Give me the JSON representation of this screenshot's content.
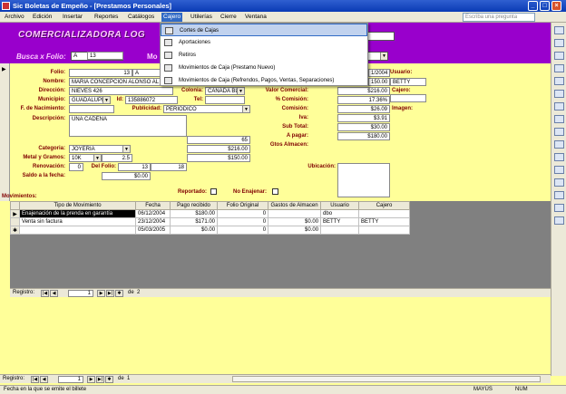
{
  "window": {
    "title": "Sic Boletas de Empeño - [Prestamos Personales]"
  },
  "menu": {
    "items": [
      "Archivo",
      "Edición",
      "Insertar",
      "Reportes",
      "Catálogos",
      "Cajero",
      "Utilerías",
      "Cierre",
      "Ventana"
    ],
    "help_placeholder": "Escriba una pregunta"
  },
  "cajero_menu": {
    "items": [
      "Cortes de Cajas",
      "Aportaciones",
      "Retiros",
      "Movimientos de Caja (Prestamo Nuevo)",
      "Movimientos de Caja (Refrendos, Pagos, Ventas, Separaciones)"
    ]
  },
  "header": {
    "company": "COMERCIALIZADORA LOG",
    "search_label": "Busca x Folio:",
    "search_value": "A",
    "search_value2": "13",
    "partial_label": "Mo"
  },
  "form": {
    "folio_label": "Folio:",
    "folio_prefix": "13",
    "folio_suffix": "A",
    "nombre_label": "Nombre:",
    "nombre_value": "MARIA CONCEPCION ALONSO AL",
    "direccion_label": "Dirección:",
    "direccion_value": "NIEVES 426",
    "colonia_label": "Colonia:",
    "colonia_value": "CAÑADA BL",
    "municipio_label": "Municipio:",
    "municipio_value": "GUADALUPI",
    "id_label": "Id:",
    "id_value": "135886072",
    "tel_label": "Tel:",
    "nacimiento_label": "F. de Nacimiento:",
    "publicidad_label": "Publicidad:",
    "publicidad_value": "PERIODICO",
    "descripcion_label": "Descripción:",
    "descripcion_value": "UNA CADENA",
    "num_65": "65",
    "num_216": "$216.00",
    "categoria_label": "Categoria:",
    "categoria_value": "JOYERIA",
    "metal_label": "Metal y Gramos:",
    "metal_value": "10K",
    "gramos_value": "2.5",
    "metal_amount": "$150.00",
    "renovacion_label": "Renovación:",
    "renovacion_value": "0",
    "del_folio_label": "Del Folio:",
    "del_folio_value": "13",
    "del_folio_value2": "18",
    "saldo_label": "Saldo a la fecha:",
    "saldo_value": "$0.00",
    "date_value": "1/2004",
    "usuario_label": "Usuario:",
    "usuario_value": "BETTY",
    "amount_150": "150.00",
    "valor_label": "Valor Comercial:",
    "valor_value": "$216.00",
    "cajero_label": "Cajero:",
    "comision_pct_label": "% Comisión:",
    "comision_pct_value": "17.36%",
    "imagen_label": "Imagen:",
    "comision_label": "Comisión:",
    "comision_value": "$26.09",
    "iva_label": "Iva:",
    "iva_value": "$3.91",
    "subtotal_label": "Sub Total:",
    "subtotal_value": "$30.00",
    "apagar_label": "A pagar:",
    "apagar_value": "$180.00",
    "gastos_label": "Gtos Almacen:",
    "ubicacion_label": "Ubicación:",
    "reportado_label": "Reportado:",
    "no_enajenar_label": "No Enajenar:",
    "movimientos_label": "Movimientos:"
  },
  "movements": {
    "headers": [
      "Tipo de Movimiento",
      "Fecha",
      "Pago recibido",
      "Folio Original",
      "Gastos de Almacen",
      "Usuario",
      "Cajero"
    ],
    "rows": [
      [
        "Enajenación de la prenda en garantía",
        "06/12/2004",
        "$180.00",
        "0",
        "",
        "dbo",
        ""
      ],
      [
        "Venta sin factura",
        "23/12/2004",
        "$171.00",
        "0",
        "$0.00",
        "BETTY",
        "BETTY"
      ],
      [
        "",
        "05/03/2005",
        "$0.00",
        "0",
        "$0.00",
        "",
        ""
      ]
    ]
  },
  "subnav": {
    "label": "Registro:",
    "current": "1",
    "of_label": "de",
    "total": "2"
  },
  "mainnav": {
    "label": "Registro:",
    "current": "1",
    "of_label": "de",
    "total": "1"
  },
  "status": {
    "text": "Fecha en la que se emite el billete",
    "caps": "MAYÚS",
    "num": "NUM"
  }
}
